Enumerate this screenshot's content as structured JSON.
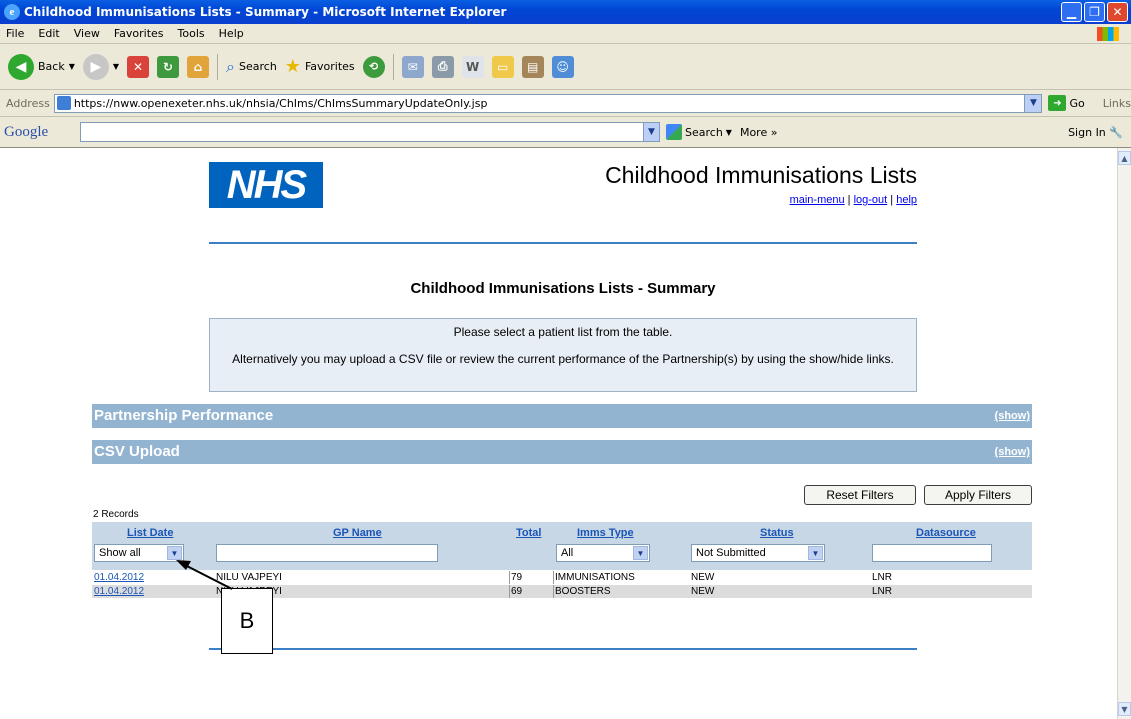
{
  "window": {
    "title": "Childhood Immunisations Lists - Summary - Microsoft Internet Explorer"
  },
  "menu": [
    "File",
    "Edit",
    "View",
    "Favorites",
    "Tools",
    "Help"
  ],
  "toolbar": {
    "back": "Back",
    "search": "Search",
    "favorites": "Favorites"
  },
  "address": {
    "label": "Address",
    "url": "https://nww.openexeter.nhs.uk/nhsia/ChIms/ChImsSummaryUpdateOnly.jsp",
    "go": "Go",
    "links": "Links"
  },
  "google": {
    "logo": "Google",
    "search": "Search",
    "more": "More »",
    "signin": "Sign In"
  },
  "page": {
    "logo": "NHS",
    "app_title": "Childhood Immunisations Lists",
    "links": {
      "main_menu": "main-menu",
      "logout": "log-out",
      "help": "help",
      "sep": "|"
    },
    "title": "Childhood Immunisations Lists - Summary",
    "info_line1": "Please select a patient list from the table.",
    "info_line2": "Alternatively you may upload a CSV file or review the current performance of the Partnership(s) by using the show/hide links.",
    "sections": [
      {
        "label": "Partnership Performance",
        "link": "(show)"
      },
      {
        "label": "CSV Upload",
        "link": "(show)"
      }
    ],
    "buttons": {
      "reset": "Reset Filters",
      "apply": "Apply Filters"
    },
    "records": "2 Records",
    "columns": {
      "list_date": "List Date",
      "gp_name": "GP Name",
      "total": "Total",
      "imms_type": "Imms Type",
      "status": "Status",
      "datasource": "Datasource"
    },
    "filters": {
      "list_date": "Show all",
      "imms_type": "All",
      "status": "Not Submitted"
    },
    "rows": [
      {
        "date": "01.04.2012",
        "gp": "NILU VAJPEYI",
        "total": "79",
        "imms": "IMMUNISATIONS",
        "status": "NEW",
        "source": "LNR"
      },
      {
        "date": "01.04.2012",
        "gp": "NILU VAJPEYI",
        "total": "69",
        "imms": "BOOSTERS",
        "status": "NEW",
        "source": "LNR"
      }
    ],
    "callout": "B"
  }
}
